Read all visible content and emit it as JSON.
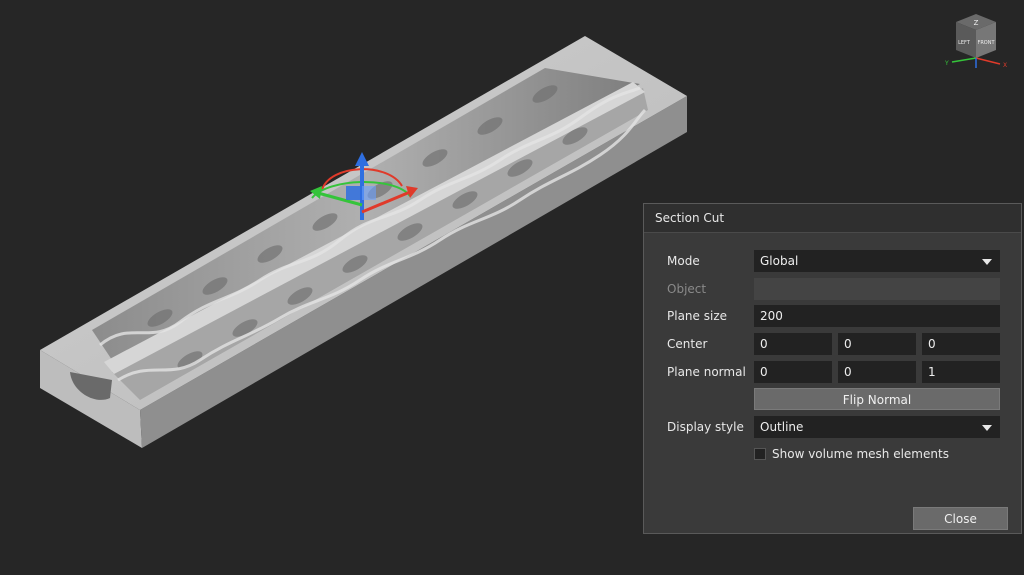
{
  "section_cut": {
    "title": "Section Cut",
    "mode": {
      "label": "Mode",
      "value": "Global"
    },
    "object": {
      "label": "Object",
      "value": ""
    },
    "plane_size": {
      "label": "Plane size",
      "value": "200"
    },
    "center": {
      "label": "Center",
      "x": "0",
      "y": "0",
      "z": "0"
    },
    "plane_normal": {
      "label": "Plane normal",
      "x": "0",
      "y": "0",
      "z": "1"
    },
    "flip_normal_label": "Flip Normal",
    "display_style": {
      "label": "Display style",
      "value": "Outline"
    },
    "show_volume_mesh": {
      "label": "Show volume mesh elements",
      "checked": false
    },
    "close_label": "Close"
  },
  "view_cube": {
    "faces": {
      "top": "Z",
      "left": "LEFT",
      "front": "FRONT"
    },
    "axes": {
      "x": "X",
      "y": "Y"
    }
  },
  "colors": {
    "background": "#262626",
    "panel": "#3a3a3a",
    "field": "#222222",
    "button": "#6a6a6a",
    "axis_x": "#e03a2a",
    "axis_y": "#35c43a",
    "axis_z": "#2f6fe0"
  }
}
